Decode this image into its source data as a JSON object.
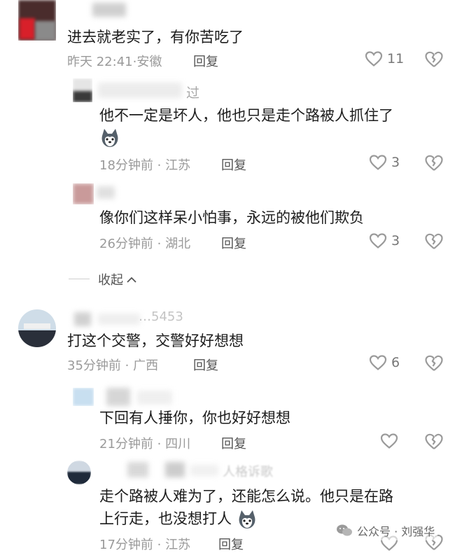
{
  "comments": [
    {
      "text": "进去就老实了，有你苦吃了",
      "time": "昨天 22:41",
      "location": "安徽",
      "reply": "回复",
      "likes": "11"
    },
    {
      "username": "过",
      "text": "他不一定是坏人，他也只是走个路被人抓住了",
      "time": "18分钟前",
      "location": "江苏",
      "reply": "回复",
      "likes": "3"
    },
    {
      "text": "像你们这样呆小怕事，永远的被他们欺负",
      "time": "26分钟前",
      "location": "湖北",
      "reply": "回复",
      "likes": "3"
    },
    {
      "username": "…5453",
      "text": "打这个交警，交警好好想想",
      "time": "35分钟前",
      "location": "广西",
      "reply": "回复",
      "likes": "6"
    },
    {
      "text": "下回有人捶你，你也好好想想",
      "time": "21分钟前",
      "location": "四川",
      "reply": "回复",
      "likes": ""
    },
    {
      "username": "人格诉歌",
      "text_line1": "走个路被人难为了，还能怎么说。他只是在路",
      "text_line2": "上行走，也没想打人",
      "time": "17分钟前",
      "location": "江苏",
      "reply": "回复",
      "likes": ""
    }
  ],
  "collapse": {
    "label": "收起"
  },
  "watermark": {
    "text": "公众号 · 刘强华"
  },
  "icons": {
    "like": "heart-outline-icon",
    "dislike": "broken-heart-icon",
    "emoji": "husky-dog-emoji-icon",
    "collapse": "chevron-up-icon",
    "watermark": "wechat-official-account-icon"
  },
  "colors": {
    "body_text": "#1c1c1c",
    "meta_text": "#9a9a9a",
    "reply_text": "#555555",
    "icon_gray": "#9a9a9a"
  }
}
